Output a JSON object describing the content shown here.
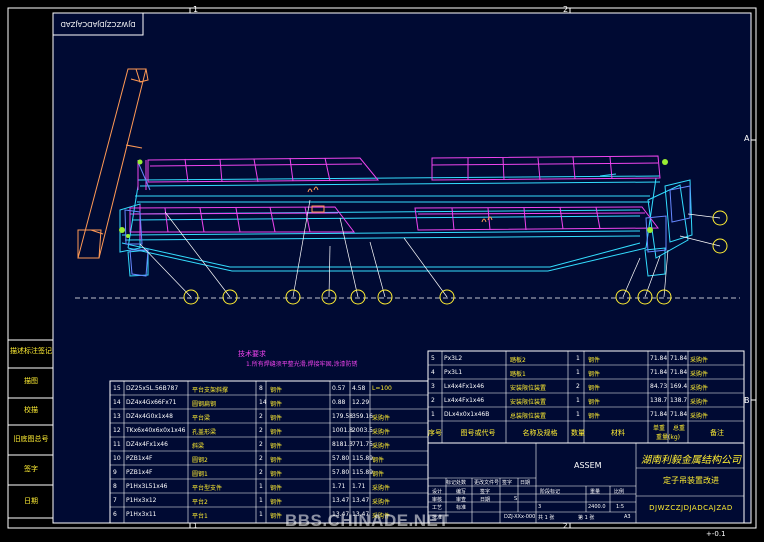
{
  "drawing": {
    "code_top": "DJWZCZJDJADCAJZAD",
    "code_bottom": "DJWZCZJDJADCAJZAD",
    "zone_numbers": [
      "1",
      "2"
    ],
    "zone_letters": [
      "A",
      "B"
    ],
    "note_title": "技术要求",
    "note_line": "1.所有焊缝须平整光滑,焊接牢固,涂漆防锈",
    "corner_info": "+-0.1"
  },
  "sidebar_labels": [
    "描述标注签记",
    "描图",
    "校描",
    "旧底图总号",
    "签字",
    "日期"
  ],
  "left_parts": [
    {
      "no": "15",
      "code": "DZ25x5L.56B787",
      "name": "平台支架斜撑",
      "qty": "8",
      "mat": "钢件",
      "w": "0.57",
      "tw": "4.58",
      "note": "L=100"
    },
    {
      "no": "14",
      "code": "DZ4x4Gx66Fx71",
      "name": "圆钢扁钢",
      "qty": "14",
      "mat": "钢件",
      "w": "0.88",
      "tw": "12.29",
      "note": ""
    },
    {
      "no": "13",
      "code": "DZ4x4G0x1x48",
      "name": "平台梁",
      "qty": "2",
      "mat": "钢件",
      "w": "179.58",
      "tw": "359.16",
      "note": "采购件"
    },
    {
      "no": "12",
      "code": "TKx6x40x6x0x1x46",
      "name": "孔盖形梁",
      "qty": "2",
      "mat": "钢件",
      "w": "1001.8",
      "tw": "2003.5",
      "note": "采购件"
    },
    {
      "no": "11",
      "code": "DZ4x4Fx1x46",
      "name": "斜梁",
      "qty": "2",
      "mat": "钢件",
      "w": "8181.3",
      "tw": "771.75",
      "note": "采购件"
    },
    {
      "no": "10",
      "code": "PZB1x4F",
      "name": "圆钢2",
      "qty": "2",
      "mat": "钢件",
      "w": "57.80",
      "tw": "115.89",
      "note": "钢件"
    },
    {
      "no": "9",
      "code": "PZB1x4F",
      "name": "圆钢1",
      "qty": "2",
      "mat": "钢件",
      "w": "57.80",
      "tw": "115.89",
      "note": "钢件"
    },
    {
      "no": "8",
      "code": "P1Hx3L51x46",
      "name": "平台型支件",
      "qty": "1",
      "mat": "钢件",
      "w": "1.71",
      "tw": "1.71",
      "note": "采购件"
    },
    {
      "no": "7",
      "code": "P1Hx3x12",
      "name": "平台2",
      "qty": "1",
      "mat": "钢件",
      "w": "13.47",
      "tw": "13.47",
      "note": "采购件"
    },
    {
      "no": "6",
      "code": "P1Hx3x11",
      "name": "平台1",
      "qty": "1",
      "mat": "钢件",
      "w": "13.47",
      "tw": "13.47",
      "note": "采购件"
    }
  ],
  "right_parts": [
    {
      "no": "5",
      "code": "Px3L2",
      "name": "踏板2",
      "qty": "1",
      "mat": "钢件",
      "w": "71.84",
      "tw": "71.84",
      "note": "采购件"
    },
    {
      "no": "4",
      "code": "Px3L1",
      "name": "踏板1",
      "qty": "1",
      "mat": "钢件",
      "w": "71.84",
      "tw": "71.84",
      "note": "采购件"
    },
    {
      "no": "3",
      "code": "Lx4x4Fx1x46",
      "name": "安装限位装置",
      "qty": "2",
      "mat": "钢件",
      "w": "84.73",
      "tw": "169.4",
      "note": "采购件"
    },
    {
      "no": "2",
      "code": "Lx4x4Fx1x46",
      "name": "安装限位装置",
      "qty": "1",
      "mat": "钢件",
      "w": "138.7",
      "tw": "138.7",
      "note": "采购件"
    },
    {
      "no": "1",
      "code": "DLx4x0x1x46B",
      "name": "总装限位装置",
      "qty": "1",
      "mat": "钢件",
      "w": "71.84",
      "tw": "71.84",
      "note": "采购件"
    }
  ],
  "bom_header": [
    "序号",
    "图号或代号",
    "名称及规格",
    "数量",
    "材料",
    "单重",
    "总重",
    "重量(kg)",
    "备注"
  ],
  "title_block": {
    "assembly": "ASSEM",
    "company": "湖南利毅金属结构公司",
    "drawing_name": "定子吊装置改进",
    "drawing_code": "DJWZCZJDJADCAJZAD",
    "sign_rows": [
      "设计",
      "审核",
      "工艺",
      "批准"
    ],
    "sign_col1": [
      "编写",
      "审查",
      "标准"
    ],
    "sign_col2": [
      "签字",
      "日期"
    ],
    "header_cells": [
      "标记",
      "处数",
      "更改文件号",
      "签字",
      "日期"
    ],
    "stage_label": "阶段标记",
    "weight_label": "重量",
    "scale_label": "比例",
    "weight_value": "2400.0",
    "scale_value": "1:5",
    "sheet_total": "共 1 张",
    "sheet_no": "第 1 张",
    "format": "A3",
    "standard": "DZJ-XXx-000",
    "stage_value": "S",
    "mark_value": "3"
  },
  "watermark": "BBS.CHINADE.NET"
}
